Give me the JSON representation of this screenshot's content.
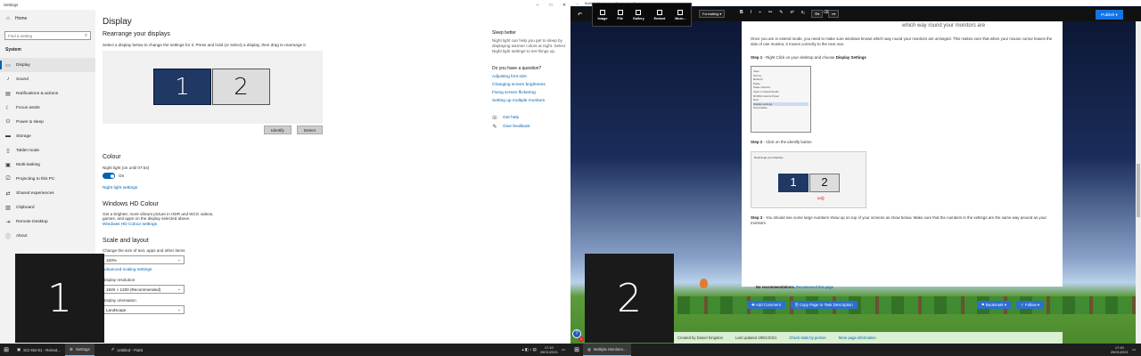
{
  "settings": {
    "window_title": "Settings",
    "home": "Home",
    "search_placeholder": "Find a setting",
    "section": "System",
    "nav": [
      {
        "label": "Display",
        "icon": "monitor-icon"
      },
      {
        "label": "Sound",
        "icon": "speaker-icon"
      },
      {
        "label": "Notifications & actions",
        "icon": "message-icon"
      },
      {
        "label": "Focus assist",
        "icon": "moon-icon"
      },
      {
        "label": "Power & sleep",
        "icon": "power-icon"
      },
      {
        "label": "Storage",
        "icon": "drive-icon"
      },
      {
        "label": "Tablet mode",
        "icon": "tablet-icon"
      },
      {
        "label": "Multi-tasking",
        "icon": "multitask-icon"
      },
      {
        "label": "Projecting to this PC",
        "icon": "project-icon"
      },
      {
        "label": "Shared experiences",
        "icon": "share-icon"
      },
      {
        "label": "Clipboard",
        "icon": "clipboard-icon"
      },
      {
        "label": "Remote Desktop",
        "icon": "remote-icon"
      },
      {
        "label": "About",
        "icon": "info-icon"
      }
    ],
    "page_title": "Display",
    "rearrange_heading": "Rearrange your displays",
    "rearrange_desc": "Select a display below to change the settings for it. Press and hold (or select) a display, then drag to rearrange it.",
    "display_1": "1",
    "display_2": "2",
    "identify": "Identify",
    "detect": "Detect",
    "colour_heading": "Colour",
    "night_light": "Night light (on until 07:54)",
    "toggle_state": "On",
    "night_light_settings": "Night light settings",
    "hd_heading": "Windows HD Colour",
    "hd_desc": "Get a brighter, more vibrant picture in HDR and WCG videos, games, and apps on the display selected above.",
    "hd_link": "Windows HD Colour settings",
    "scale_heading": "Scale and layout",
    "scale_label": "Change the size of text, apps and other items",
    "scale_value": "100%",
    "advanced_scaling": "Advanced scaling settings",
    "resolution_label": "Display resolution",
    "resolution_value": "1920 × 1200 (Recommended)",
    "orientation_label": "Display orientation",
    "orientation_value": "Landscape",
    "sleep_heading": "Sleep better",
    "sleep_text": "Night light can help you get to sleep by displaying warmer colors at night. Select Night light settings to set things up.",
    "question_heading": "Do you have a question?",
    "question_links": [
      "Adjusting font size",
      "Changing screen brightness",
      "Fixing screen flickering",
      "Setting up multiple monitors"
    ],
    "get_help": "Get help",
    "give_feedback": "Give feedback"
  },
  "identify_overlay_1": "1",
  "identify_overlay_2": "2",
  "taskbar_left": {
    "items": [
      "SCI-NS-01 - Remot...",
      "Settings",
      "Untitled - Paint"
    ],
    "time": "17:40",
    "date": "29/01/2021"
  },
  "taskbar_right": {
    "items": [
      "Multiple Monitors..."
    ],
    "time": "17:40",
    "date": "29/01/2021"
  },
  "editor": {
    "browser_title": "Multiple Monitors — Remember Server",
    "insert_items": [
      "Image",
      "File",
      "Gallery",
      "Embed",
      "More..."
    ],
    "formatting": "Formatting",
    "publish": "Publish",
    "heading_partial": "which way round your monitors are",
    "intro": "Once you are in extend mode, you need to make sure windows knows which way round your monitors are arranged. This makes sure that when your mouse cursor leaves the side of one monitor, it moves correctly to the next one.",
    "step1_label": "Step 1",
    "step1_text": " - Right Click on your desktop and choose ",
    "step1_bold": "Display Settings",
    "context_menu": [
      "View",
      "Sort by",
      "Refresh",
      "Paste",
      "Paste shortcut",
      "Open in Visual Studio",
      "NVIDIA Control Panel",
      "New",
      "Display settings",
      "Personalise"
    ],
    "step2_label": "Step 2",
    "step2_text": " - Click on the identify button",
    "mini_title": "Rearrange your displays",
    "step3_label": "Step 3",
    "step3_text": " - You should see some large numbers show up on top of your screens as show below. Make sure that the numbers in the settings are the same way around as your monitors",
    "no_recommend": "No recommendations.",
    "recommend_link": "Recommend this page",
    "actions": [
      "Add Comment",
      "Copy Page to Task Description",
      "Bookmark",
      "Follow"
    ],
    "footer_created": "Created by Daniel Kingston",
    "footer_updated": "Last updated 29/01/2021",
    "footer_stats": "Check stats by person",
    "footer_more": "More page information",
    "help_badge": "1"
  }
}
